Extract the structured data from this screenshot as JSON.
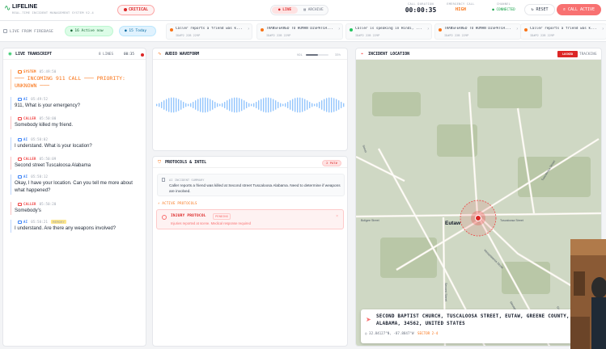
{
  "header": {
    "app_title": "LIFELINE",
    "app_subtitle": "REAL-TIME INCIDENT MANAGEMENT SYSTEM V2.4",
    "priority_badge": "CRITICAL",
    "mode_live": "LIVE",
    "mode_archive": "ARCHIVE",
    "call_duration_label": "CALL DURATION",
    "call_duration": "00:00:35",
    "emergency_call_label": "EMERGENCY CALL",
    "emergency_call_value": "HIGH",
    "channel_label": "CHANNEL",
    "channel_value": "CONNECTED",
    "reset_label": "RESET",
    "call_active_label": "CALL ACTIVE"
  },
  "ticker": {
    "label": "LIVE FROM FIREBASE",
    "active_pill": "16 Active now",
    "today_pill": "15 Today",
    "cards": [
      {
        "text": "Caller reports a friend was k...",
        "sub": "ID#P2 22B 229P",
        "color": "#f97316"
      },
      {
        "text": "TRANSFERRED TO HUMAN DISPATCH...",
        "sub": "ID#P2 22B 229P",
        "color": "#f97316"
      },
      {
        "text": "Caller is speaking in Hindi, ...",
        "sub": "ID#P2 22B 229P",
        "color": "#22c55e"
      },
      {
        "text": "TRANSFERRED TO HUMAN DISPATCH...",
        "sub": "ID#P2 22B 229P",
        "color": "#f97316"
      },
      {
        "text": "Caller reports a friend was k...",
        "sub": "ID#P2 22B 229P",
        "color": "#f97316"
      }
    ]
  },
  "transcript": {
    "title": "LIVE TRANSCRIPT",
    "lines": "8 LINES",
    "timer": "00:35",
    "messages": [
      {
        "role": "SYSTEM",
        "time": "05:49:50",
        "text": "─── INCOMING 911 CALL ─── PRIORITY: UNKNOWN ───"
      },
      {
        "role": "AI",
        "time": "05:49:52",
        "text": "911, What is your emergency?"
      },
      {
        "role": "CALLER",
        "time": "05:50:00",
        "text": "Somebody killed my friend."
      },
      {
        "role": "AI",
        "time": "05:50:02",
        "text": "I understand. What is your location?"
      },
      {
        "role": "CALLER",
        "time": "05:50:09",
        "text": "Second street Tuscaloosa Alabama"
      },
      {
        "role": "AI",
        "time": "05:50:12",
        "text": "Okay, I have your location. Can you tell me more about what happened?"
      },
      {
        "role": "CALLER",
        "time": "05:50:20",
        "text": "Somebody's"
      },
      {
        "role": "AI",
        "time": "05:50:21",
        "tag": "MEMORY",
        "text": "I understand. Are there any weapons involved?"
      }
    ]
  },
  "waveform": {
    "title": "AUDIO WAVEFORM",
    "vol_label": "VOL",
    "volume_fraction": 0.55,
    "vol_pct": "33%"
  },
  "protocols": {
    "title": "PROTOCOLS & INTEL",
    "patch_badge": "2 PAT#",
    "incident_label": "AI INCIDENT SUMMARY",
    "incident_text": "Caller reports a friend was killed at Second street Tuscaloosa Alabama. Need to determine if weapons are involved.",
    "active_label": "ACTIVE PROTOCOLS",
    "protocol_name": "INJURY PROTOCOL",
    "protocol_status": "PENDING",
    "protocol_desc": "Injuries reported at scene. Medical response required"
  },
  "location": {
    "title": "INCIDENT LOCATION",
    "status": "LOCKED",
    "tracking": "TRACKING",
    "place_label": "Eutaw",
    "address": "SECOND BAPTIST CHURCH, TUSCALOOSA STREET, EUTAW, GREENE COUNTY, ALABAMA, 34562, UNITED STATES",
    "coords": "32.84127°N, -87.8847°W",
    "sector": "SECTOR 2-4",
    "street_labels": [
      "Street",
      "Tuscaloosa Street",
      "Tuscaloosa Street",
      "Mesopotamia Street",
      "Second Street",
      "Mesopotamia Street",
      "Boligee Street",
      "Greensboro"
    ]
  },
  "colors": {
    "accent": "#f97316",
    "critical": "#dc2626",
    "ai": "#3b82f6",
    "live": "#16a34a"
  }
}
